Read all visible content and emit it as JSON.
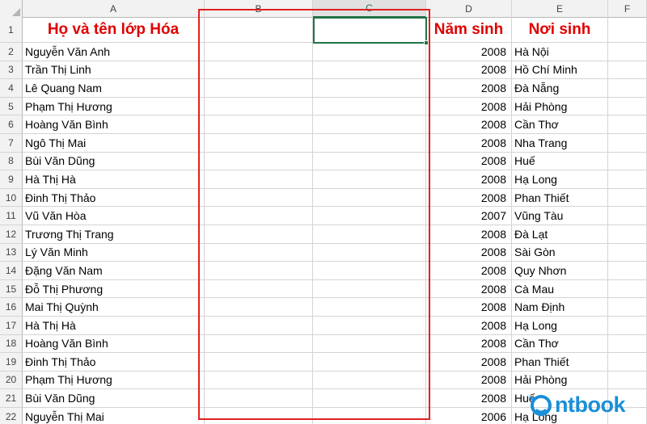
{
  "columns": [
    "A",
    "B",
    "C",
    "D",
    "E",
    "F"
  ],
  "header_row": {
    "row_number": "1",
    "name_header": "Họ và tên lớp Hóa",
    "b": "",
    "c": "",
    "year_header": "Năm sinh",
    "place_header": "Nơi sinh"
  },
  "rows": [
    {
      "n": "2",
      "name": "Nguyễn Văn Anh",
      "year": "2008",
      "place": "Hà Nội"
    },
    {
      "n": "3",
      "name": "Trần Thị Linh",
      "year": "2008",
      "place": "Hồ Chí Minh"
    },
    {
      "n": "4",
      "name": "Lê Quang Nam",
      "year": "2008",
      "place": "Đà Nẵng"
    },
    {
      "n": "5",
      "name": "Phạm Thị Hương",
      "year": "2008",
      "place": "Hải Phòng"
    },
    {
      "n": "6",
      "name": "Hoàng Văn Bình",
      "year": "2008",
      "place": "Cần Thơ"
    },
    {
      "n": "7",
      "name": "Ngô Thị Mai",
      "year": "2008",
      "place": "Nha Trang"
    },
    {
      "n": "8",
      "name": "Bùi Văn Dũng",
      "year": "2008",
      "place": "Huế"
    },
    {
      "n": "9",
      "name": "Hà Thị Hà",
      "year": "2008",
      "place": "Hạ Long"
    },
    {
      "n": "10",
      "name": "Đinh Thị Thảo",
      "year": "2008",
      "place": "Phan Thiết"
    },
    {
      "n": "11",
      "name": "Vũ Văn Hòa",
      "year": "2007",
      "place": "Vũng Tàu"
    },
    {
      "n": "12",
      "name": "Trương Thị Trang",
      "year": "2008",
      "place": "Đà Lạt"
    },
    {
      "n": "13",
      "name": "Lý Văn Minh",
      "year": "2008",
      "place": "Sài Gòn"
    },
    {
      "n": "14",
      "name": "Đặng Văn Nam",
      "year": "2008",
      "place": "Quy Nhơn"
    },
    {
      "n": "15",
      "name": "Đỗ Thị Phương",
      "year": "2008",
      "place": "Cà Mau"
    },
    {
      "n": "16",
      "name": "Mai Thị Quỳnh",
      "year": "2008",
      "place": "Nam Định"
    },
    {
      "n": "17",
      "name": "Hà Thị Hà",
      "year": "2008",
      "place": "Hạ Long"
    },
    {
      "n": "18",
      "name": "Hoàng Văn Bình",
      "year": "2008",
      "place": "Cần Thơ"
    },
    {
      "n": "19",
      "name": "Đinh Thị Thảo",
      "year": "2008",
      "place": "Phan Thiết"
    },
    {
      "n": "20",
      "name": "Phạm Thị Hương",
      "year": "2008",
      "place": "Hải Phòng"
    },
    {
      "n": "21",
      "name": "Bùi Văn Dũng",
      "year": "2008",
      "place": "Huế"
    },
    {
      "n": "22",
      "name": "Nguyễn Thị Mai",
      "year": "2006",
      "place": "Hạ Long"
    }
  ],
  "selected_cell": "C1",
  "colors": {
    "header_text": "#e00000",
    "highlight_border": "#e02020",
    "selection": "#217346",
    "logo": "#1a8fd8"
  },
  "watermark": {
    "text": "ntbook",
    "icon": "o-logo-icon"
  }
}
